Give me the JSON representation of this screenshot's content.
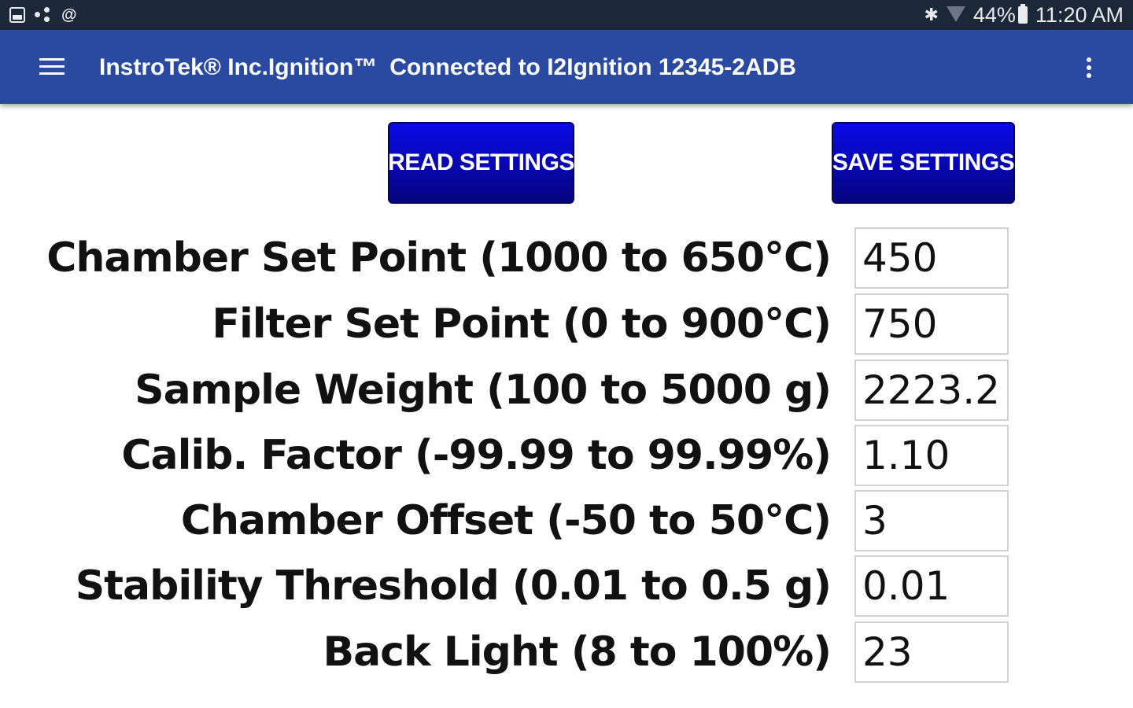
{
  "status_bar": {
    "left_icons": [
      "gallery-icon",
      "share-icon",
      "at-icon"
    ],
    "icon_at": "@",
    "bluetooth": "✱",
    "battery": "44%",
    "time": "11:20 AM"
  },
  "app_bar": {
    "title": "InstroTek® Inc.Ignition™",
    "connection": "Connected to I2Ignition 12345-2ADB",
    "color": "#2a4aa1"
  },
  "buttons": {
    "read_label": "READ SETTINGS",
    "save_label": "SAVE SETTINGS",
    "color": "#0a0ae8"
  },
  "settings": [
    {
      "label": "Chamber Set Point (1000 to 650°C)",
      "value": "450"
    },
    {
      "label": "Filter Set Point (0 to 900°C)",
      "value": "750"
    },
    {
      "label": "Sample Weight (100 to 5000 g)",
      "value": "2223.2"
    },
    {
      "label": "Calib. Factor (-99.99 to 99.99%)",
      "value": "1.10"
    },
    {
      "label": "Chamber Offset (-50 to 50°C)",
      "value": "3"
    },
    {
      "label": "Stability Threshold (0.01 to 0.5 g)",
      "value": "0.01"
    },
    {
      "label": "Back Light (8 to 100%)",
      "value": "23"
    }
  ]
}
